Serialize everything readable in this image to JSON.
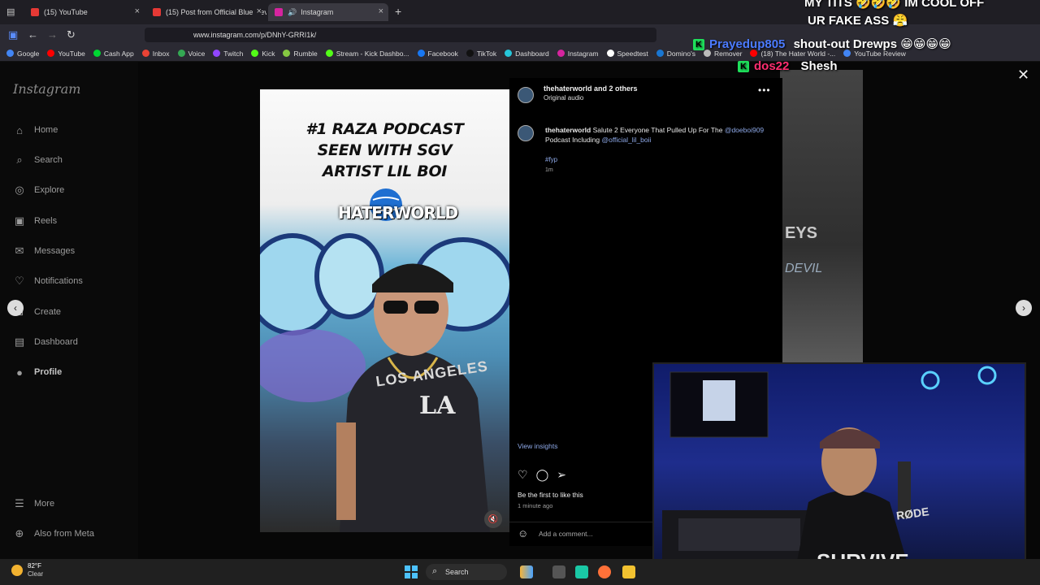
{
  "browser": {
    "tabs": [
      {
        "title": "(15) YouTube",
        "color": "#e53935"
      },
      {
        "title": "(15) Post from Official Blue Dev",
        "color": "#e53935"
      },
      {
        "title": "Instagram",
        "color": "#d6249f"
      }
    ],
    "new_tab": "+",
    "url": "www.instagram.com/p/DNhY-GRRI1k/",
    "bookmarks": [
      {
        "label": "Google",
        "color": "#4285f4"
      },
      {
        "label": "YouTube",
        "color": "#ff0000"
      },
      {
        "label": "Cash App",
        "color": "#00d632"
      },
      {
        "label": "Inbox",
        "color": "#ea4335"
      },
      {
        "label": "Voice",
        "color": "#34a853"
      },
      {
        "label": "Twitch",
        "color": "#9146ff"
      },
      {
        "label": "Kick",
        "color": "#53fc18"
      },
      {
        "label": "Rumble",
        "color": "#85c742"
      },
      {
        "label": "Stream - Kick Dashbo...",
        "color": "#53fc18"
      },
      {
        "label": "Facebook",
        "color": "#1877f2"
      },
      {
        "label": "TikTok",
        "color": "#111111"
      },
      {
        "label": "Dashboard",
        "color": "#26c6da"
      },
      {
        "label": "Instagram",
        "color": "#d6249f"
      },
      {
        "label": "Speedtest",
        "color": "#ffffff"
      },
      {
        "label": "Domino's",
        "color": "#1976d2"
      },
      {
        "label": "Remover",
        "color": "#bbbbbb"
      },
      {
        "label": "(18) The Hater World -...",
        "color": "#ff0000"
      },
      {
        "label": "YouTube Review",
        "color": "#4285f4"
      }
    ]
  },
  "sidebar": {
    "logo": "Instagram",
    "items": [
      {
        "label": "Home",
        "icon": "home-icon",
        "glyph": "⌂"
      },
      {
        "label": "Search",
        "icon": "search-icon",
        "glyph": "⌕"
      },
      {
        "label": "Explore",
        "icon": "compass-icon",
        "glyph": "◎"
      },
      {
        "label": "Reels",
        "icon": "reels-icon",
        "glyph": "▣"
      },
      {
        "label": "Messages",
        "icon": "messenger-icon",
        "glyph": "✉"
      },
      {
        "label": "Notifications",
        "icon": "heart-icon",
        "glyph": "♡"
      },
      {
        "label": "Create",
        "icon": "plus-square-icon",
        "glyph": "⊞"
      },
      {
        "label": "Dashboard",
        "icon": "dashboard-icon",
        "glyph": "▤"
      },
      {
        "label": "Profile",
        "icon": "avatar-icon",
        "glyph": "●"
      }
    ],
    "more": "More",
    "also_from_meta": "Also from Meta"
  },
  "post": {
    "image_title_lines": [
      "#1 RAZA PODCAST",
      "SEEN WITH SGV",
      "ARTIST LIL BOI"
    ],
    "image_brand": "HATERWORLD",
    "shirt_text": "LOS ANGELES",
    "shirt_logo": "LA",
    "author": "thehaterworld",
    "coauthors": "and 2 others",
    "audio": "Original audio",
    "caption_user": "thehaterworld",
    "caption_text": "Salute 2 Everyone That Pulled Up For The",
    "mention_1": "@doeboi909",
    "caption_mid": "Podcast Including",
    "mention_2": "@official_lil_boii",
    "hashtag": "#fyp",
    "age": "1m",
    "view_insights": "View insights",
    "likes_text": "Be the first to like this",
    "time_ago": "1 minute ago",
    "comment_placeholder": "Add a comment..."
  },
  "stream": {
    "chat_top_1": "MY TITS 🤣🤣🤣 IM COOL OFF",
    "chat_top_2": "UR FAKE ASS 😤",
    "chat_user_1": "Prayedup805",
    "chat_msg_1": "shout-out Drewps 😁😁😁😁",
    "chat_user_2": "dos22",
    "chat_msg_2": "Shesh",
    "mic_brand": "RØDE",
    "shirt_word": "SURVIVE"
  },
  "taskbar": {
    "temp": "82°F",
    "condition": "Clear",
    "search_label": "Search"
  }
}
